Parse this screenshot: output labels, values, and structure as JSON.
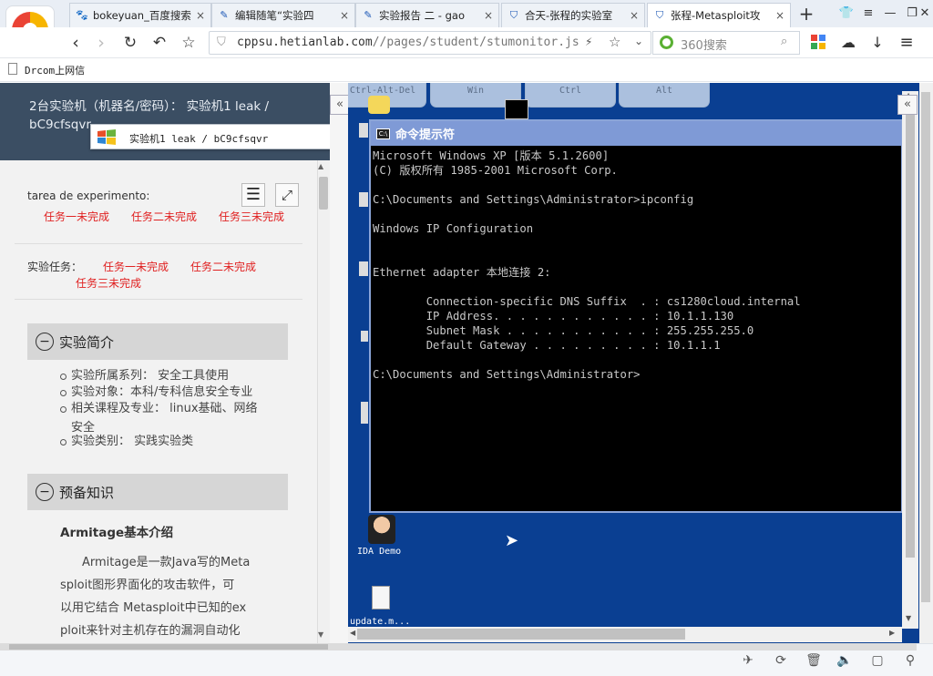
{
  "browser": {
    "tabs": [
      {
        "label": "bokeyuan_百度搜索",
        "icon": "paw-icon"
      },
      {
        "label": "编辑随笔“实验四",
        "icon": "paper-icon"
      },
      {
        "label": "实验报告 二 - gao",
        "icon": "paper-icon"
      },
      {
        "label": "合天-张程的实验室",
        "icon": "shield-icon"
      },
      {
        "label": "张程-Metasploit攻",
        "icon": "shield-icon"
      }
    ],
    "url_main": "cppsu.hetianlab.com",
    "url_path": "//pages/student/stumonitor.js",
    "search_placeholder": "360搜索",
    "bookmark": "Drcom上网信"
  },
  "left_panel": {
    "header_text": "2台实验机（机器名/密码）： 实验机1 leak / bC9cfsqvr",
    "machine_select": "实验机1    leak / bC9cfsqvr",
    "tarea_label": "tarea de experimento:",
    "tasks": [
      "任务一未完成",
      "任务二未完成",
      "任务三未完成"
    ],
    "tasks_label2": "实验任务：",
    "section1": {
      "title": "实验简介",
      "items": [
        "实验所属系列： 安全工具使用",
        "实验对象：本科/专科信息安全专业",
        "相关课程及专业： linux基础、网络",
        "安全",
        "实验类别： 实践实验类"
      ]
    },
    "section2": {
      "title": "预备知识",
      "subtitle": "Armitage基本介绍",
      "lines": [
        "Armitage是一款Java写的Meta",
        "sploit图形界面化的攻击软件，可",
        "以用它结合 Metasploit中已知的ex",
        "ploit来针对主机存在的漏洞自动化"
      ]
    }
  },
  "rdp": {
    "keys": [
      "Ctrl-Alt-Del",
      "Win",
      "Ctrl",
      "Alt"
    ],
    "cmd_title": "命令提示符",
    "cmd_lines": [
      "Microsoft Windows XP [版本 5.1.2600]",
      "(C) 版权所有 1985-2001 Microsoft Corp.",
      "",
      "C:\\Documents and Settings\\Administrator>ipconfig",
      "",
      "Windows IP Configuration",
      "",
      "",
      "Ethernet adapter 本地连接 2:",
      "",
      "        Connection-specific DNS Suffix  . : cs1280cloud.internal",
      "        IP Address. . . . . . . . . . . . : 10.1.1.130",
      "        Subnet Mask . . . . . . . . . . . : 255.255.255.0",
      "        Default Gateway . . . . . . . . . : 10.1.1.1",
      "",
      "C:\\Documents and Settings\\Administrator>"
    ],
    "desktop_icons": [
      "IDA Demo",
      "update.m..."
    ]
  },
  "colors": {
    "header_bg": "#3b4e63",
    "task_red": "#e02020",
    "xp_blue": "#0a3f92",
    "cmd_title": "#7f9ad6"
  }
}
